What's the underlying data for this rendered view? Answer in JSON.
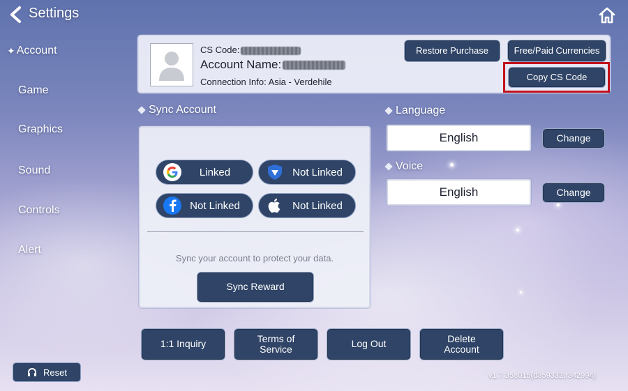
{
  "header": {
    "title": "Settings"
  },
  "sidebar": {
    "items": [
      {
        "label": "Account",
        "active": true
      },
      {
        "label": "Game"
      },
      {
        "label": "Graphics"
      },
      {
        "label": "Sound"
      },
      {
        "label": "Controls"
      },
      {
        "label": "Alert"
      }
    ],
    "reset_label": "Reset"
  },
  "account": {
    "cs_code_label": "CS Code:",
    "account_name_label": "Account Name:",
    "connection_info": "Connection Info: Asia - Verdehile",
    "restore_purchase_label": "Restore Purchase",
    "currencies_label": "Free/Paid Currencies",
    "copy_cs_code_label": "Copy CS Code"
  },
  "sync": {
    "heading": "Sync Account",
    "google_status": "Linked",
    "shield_status": "Not Linked",
    "facebook_status": "Not Linked",
    "apple_status": "Not Linked",
    "note": "Sync your account to protect your data.",
    "reward_label": "Sync Reward"
  },
  "language": {
    "heading": "Language",
    "value": "English",
    "change_label": "Change"
  },
  "voice": {
    "heading": "Voice",
    "value": "English",
    "change_label": "Change"
  },
  "footer": {
    "inquiry_label": "1:1 Inquiry",
    "terms_label": "Terms of Service",
    "logout_label": "Log Out",
    "delete_label": "Delete Account",
    "version": "v1.7.358015(d359332,r342994)"
  },
  "colors": {
    "button_bg": "#2f4466",
    "highlight": "#c2111c"
  }
}
